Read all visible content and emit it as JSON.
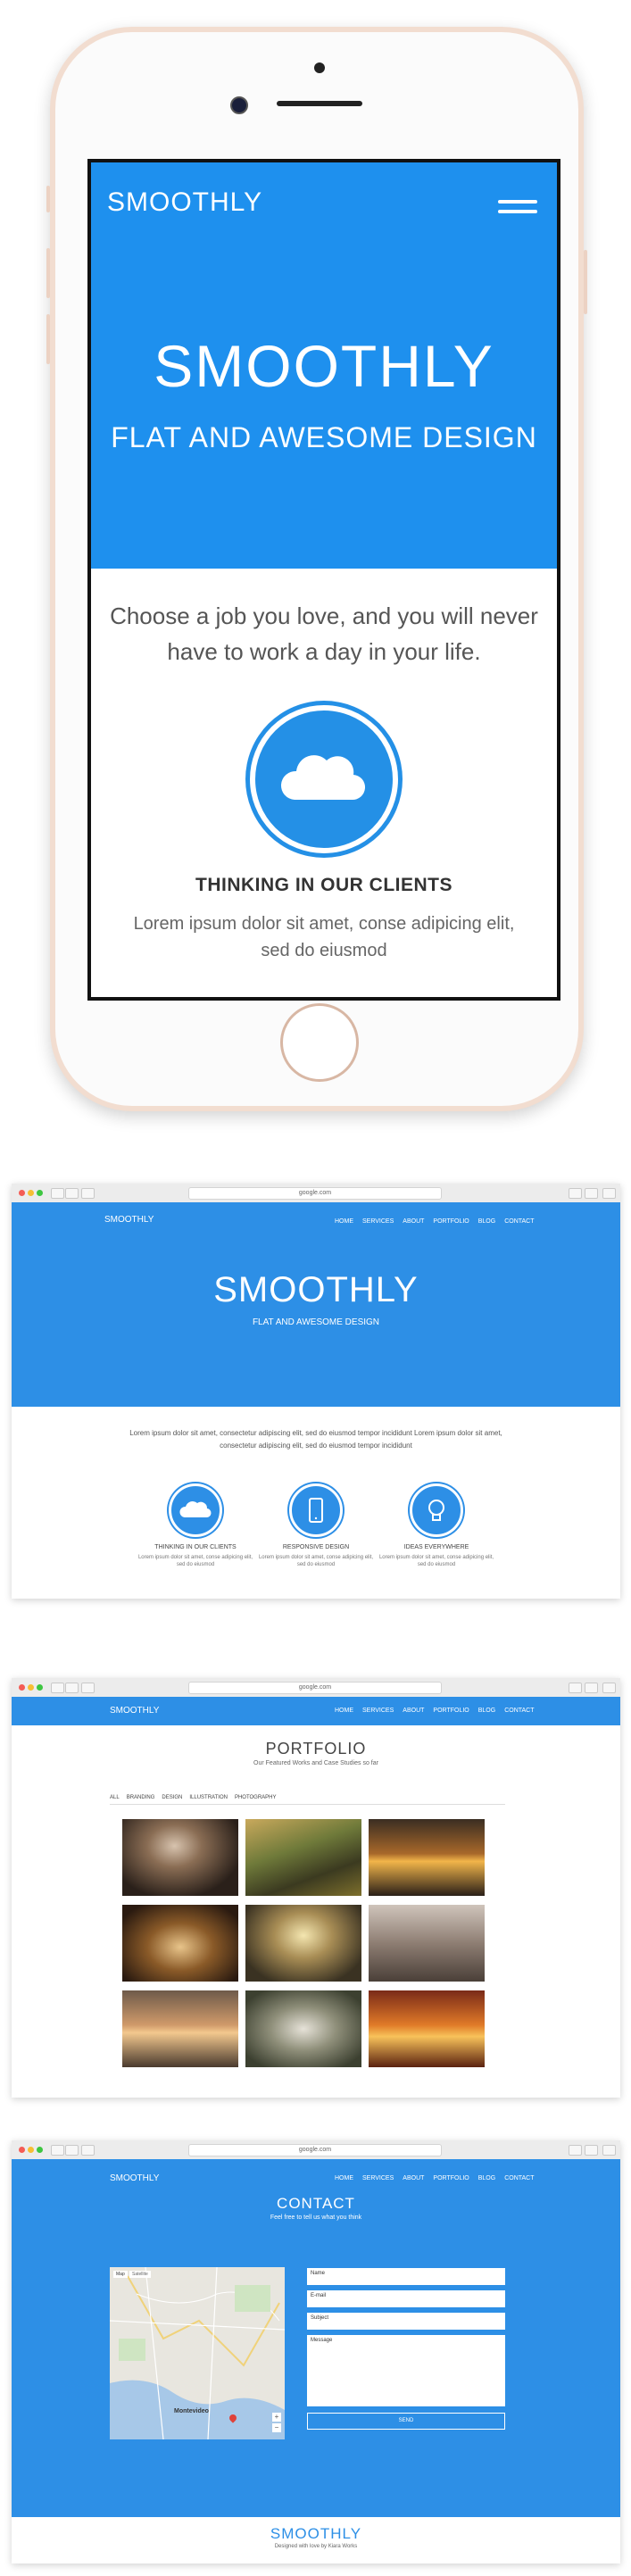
{
  "phone": {
    "brand": "SMOOTHLY",
    "hero_title": "SMOOTHLY",
    "hero_subtitle": "FLAT AND AWESOME DESIGN",
    "quote": "Choose a job you love, and you will never have to work a day in your life.",
    "feature_title": "THINKING IN OUR CLIENTS",
    "feature_text": "Lorem ipsum dolor sit amet, conse adipicing elit, sed do eiusmod",
    "feature_icon": "cloud-icon",
    "menu_icon": "hamburger-menu-icon"
  },
  "browser": {
    "url": "google.com",
    "nav": [
      "HOME",
      "SERVICES",
      "ABOUT",
      "PORTFOLIO",
      "BLOG",
      "CONTACT"
    ],
    "logo": "SMOOTHLY"
  },
  "home_page": {
    "title": "SMOOTHLY",
    "subtitle": "FLAT AND AWESOME DESIGN",
    "intro": "Lorem ipsum dolor sit amet, consectetur adipiscing elit, sed do eiusmod tempor incididunt Lorem ipsum dolor sit amet, consectetur adipiscing elit, sed do eiusmod tempor incididunt",
    "features": [
      {
        "icon": "cloud-icon",
        "title": "THINKING IN OUR CLIENTS",
        "text": "Lorem ipsum dolor sit amet, conse adipicing elit, sed do eiusmod"
      },
      {
        "icon": "phone-icon",
        "title": "RESPONSIVE DESIGN",
        "text": "Lorem ipsum dolor sit amet, conse adipicing elit, sed do eiusmod"
      },
      {
        "icon": "lightbulb-icon",
        "title": "IDEAS EVERYWHERE",
        "text": "Lorem ipsum dolor sit amet, conse adipicing elit, sed do eiusmod"
      }
    ]
  },
  "portfolio_page": {
    "title": "PORTFOLIO",
    "subtitle": "Our Featured Works and Case Studies so far",
    "filters": [
      "ALL",
      "BRANDING",
      "DESIGN",
      "ILLUSTRATION",
      "PHOTOGRAPHY"
    ]
  },
  "contact_page": {
    "title": "CONTACT",
    "subtitle": "Feel free to tell us what you think",
    "map_tabs": [
      "Map",
      "Satellite"
    ],
    "map_city": "Montevideo",
    "fields": {
      "name": "Name",
      "email": "E-mail",
      "subject": "Subject",
      "message": "Message"
    },
    "send": "SEND",
    "footer_logo": "SMOOTHLY",
    "footer_text": "Designed with love by Kiara Works"
  },
  "colors": {
    "primary": "#1e90ee",
    "accent": "#2d8fe6",
    "phone_frame": "#f2ddd0"
  }
}
